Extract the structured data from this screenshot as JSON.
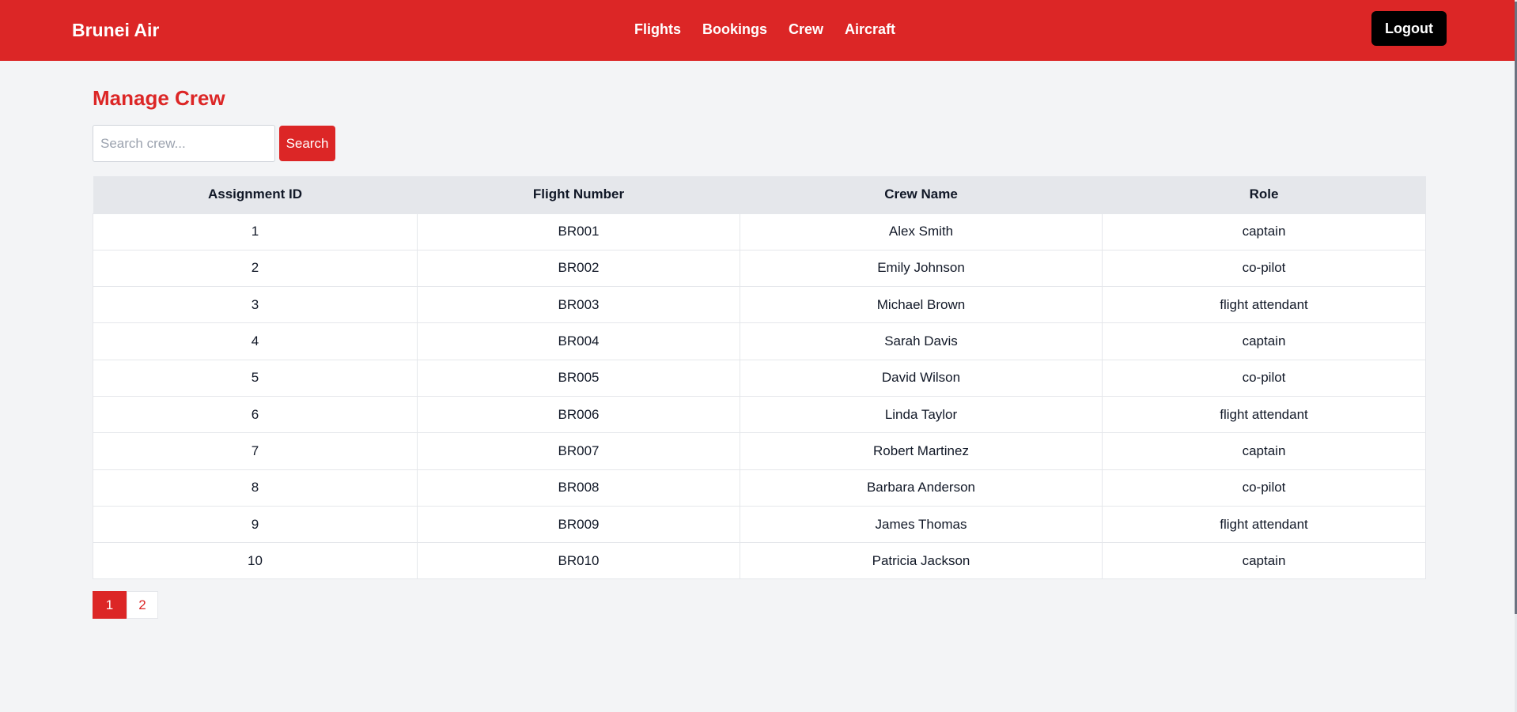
{
  "header": {
    "brand": "Brunei Air",
    "nav": [
      "Flights",
      "Bookings",
      "Crew",
      "Aircraft"
    ],
    "logout_label": "Logout"
  },
  "main": {
    "title": "Manage Crew",
    "search": {
      "placeholder": "Search crew...",
      "value": "",
      "button_label": "Search"
    },
    "table": {
      "columns": [
        "Assignment ID",
        "Flight Number",
        "Crew Name",
        "Role"
      ],
      "rows": [
        [
          "1",
          "BR001",
          "Alex Smith",
          "captain"
        ],
        [
          "2",
          "BR002",
          "Emily Johnson",
          "co-pilot"
        ],
        [
          "3",
          "BR003",
          "Michael Brown",
          "flight attendant"
        ],
        [
          "4",
          "BR004",
          "Sarah Davis",
          "captain"
        ],
        [
          "5",
          "BR005",
          "David Wilson",
          "co-pilot"
        ],
        [
          "6",
          "BR006",
          "Linda Taylor",
          "flight attendant"
        ],
        [
          "7",
          "BR007",
          "Robert Martinez",
          "captain"
        ],
        [
          "8",
          "BR008",
          "Barbara Anderson",
          "co-pilot"
        ],
        [
          "9",
          "BR009",
          "James Thomas",
          "flight attendant"
        ],
        [
          "10",
          "BR010",
          "Patricia Jackson",
          "captain"
        ]
      ]
    },
    "pagination": {
      "pages": [
        "1",
        "2"
      ],
      "current": "1"
    }
  },
  "colors": {
    "brand": "#dc2626",
    "background": "#f3f4f6",
    "table_header": "#e5e7eb",
    "logout": "#000000"
  }
}
